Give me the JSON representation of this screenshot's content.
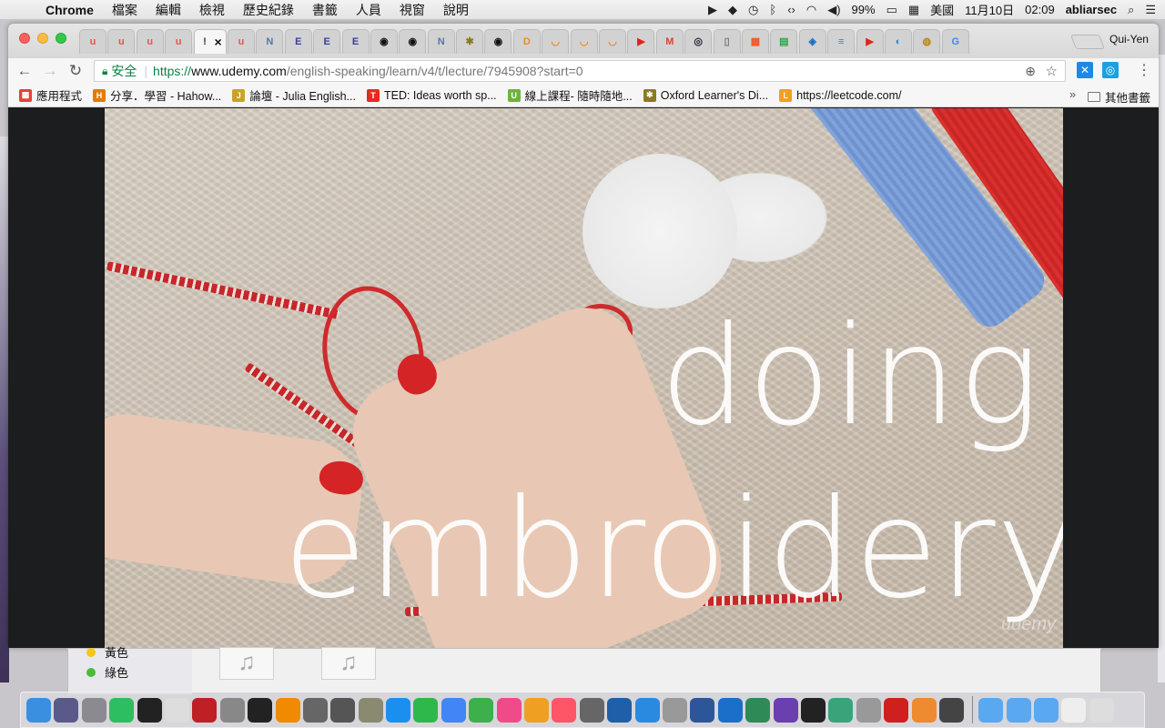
{
  "menubar": {
    "app": "Chrome",
    "menus": [
      "檔案",
      "編輯",
      "檢視",
      "歷史紀錄",
      "書籤",
      "人員",
      "視窗",
      "說明"
    ],
    "battery": "99%",
    "input_source": "美國",
    "date": "11月10日",
    "time": "02:09",
    "user": "abliarsec"
  },
  "browser": {
    "profile": "Qui-Yen",
    "tabs": [
      {
        "icon": "u",
        "color": "#ec5252"
      },
      {
        "icon": "u",
        "color": "#ec5252"
      },
      {
        "icon": "u",
        "color": "#ec5252"
      },
      {
        "icon": "u",
        "color": "#ec5252"
      },
      {
        "icon": "!",
        "color": "#333"
      },
      {
        "icon": "u",
        "color": "#ec5252"
      },
      {
        "icon": "N",
        "color": "#5577aa"
      },
      {
        "icon": "E",
        "color": "#3a3f9a"
      },
      {
        "icon": "E",
        "color": "#3a3f9a"
      },
      {
        "icon": "E",
        "color": "#3a3f9a"
      },
      {
        "icon": "◉",
        "color": "#111"
      },
      {
        "icon": "◉",
        "color": "#111"
      },
      {
        "icon": "N",
        "color": "#5577aa"
      },
      {
        "icon": "✱",
        "color": "#8a7a20"
      },
      {
        "icon": "◉",
        "color": "#111"
      },
      {
        "icon": "D",
        "color": "#f08a24"
      },
      {
        "icon": "◡",
        "color": "#f08a24"
      },
      {
        "icon": "◡",
        "color": "#f08a24"
      },
      {
        "icon": "◡",
        "color": "#f08a24"
      },
      {
        "icon": "▶",
        "color": "#e62117"
      },
      {
        "icon": "M",
        "color": "#d44638"
      },
      {
        "icon": "◎",
        "color": "#223"
      },
      {
        "icon": "▯",
        "color": "#777"
      },
      {
        "icon": "▦",
        "color": "#f35325"
      },
      {
        "icon": "▤",
        "color": "#27a844"
      },
      {
        "icon": "◈",
        "color": "#1b6fc7"
      },
      {
        "icon": "≡",
        "color": "#1e88e5"
      },
      {
        "icon": "▶",
        "color": "#e62117"
      },
      {
        "icon": "◐",
        "color": "#1e88e5"
      },
      {
        "icon": "◍",
        "color": "#b8860b"
      },
      {
        "icon": "G",
        "color": "#4285f4"
      }
    ],
    "address": {
      "secure_label": "安全",
      "scheme": "https://",
      "host_sub": "www.",
      "host": "udemy.com",
      "path": "/english-speaking/learn/v4/t/lecture/7945908?start=0"
    },
    "bookmarks": [
      {
        "label": "應用程式",
        "icon_color": "#e0443a",
        "icon": "▦"
      },
      {
        "label": "分享．學習 - Hahow...",
        "icon_color": "#e57a00",
        "icon": "H"
      },
      {
        "label": "論壇 - Julia English...",
        "icon_color": "#c9a227",
        "icon": "J"
      },
      {
        "label": "TED: Ideas worth sp...",
        "icon_color": "#e62b1e",
        "icon": "T"
      },
      {
        "label": "線上課程- 隨時隨地...",
        "icon_color": "#6cb33f",
        "icon": "U"
      },
      {
        "label": "Oxford Learner's Di...",
        "icon_color": "#8a7a20",
        "icon": "✱"
      },
      {
        "label": "https://leetcode.com/",
        "icon_color": "#f0a020",
        "icon": "L"
      }
    ],
    "bookmarks_other": "其他書籤"
  },
  "video": {
    "caption_line1": "doing",
    "caption_line2": "embroidery",
    "watermark": "udemy"
  },
  "finder": {
    "tags": [
      {
        "label": "黃色",
        "color": "#f5c518"
      },
      {
        "label": "綠色",
        "color": "#4cbb3c"
      }
    ]
  },
  "dock": {
    "apps": [
      {
        "name": "Finder",
        "color": "#3b8fe0"
      },
      {
        "name": "Siri",
        "color": "#5a5a8a"
      },
      {
        "name": "Launchpad",
        "color": "#8a8a90"
      },
      {
        "name": "Evernote",
        "color": "#2dbe60"
      },
      {
        "name": "Activity",
        "color": "#222"
      },
      {
        "name": "Script",
        "color": "#ddd"
      },
      {
        "name": "FileZilla",
        "color": "#bf2026"
      },
      {
        "name": "System Preferences",
        "color": "#888"
      },
      {
        "name": "Terminal",
        "color": "#222"
      },
      {
        "name": "VLC",
        "color": "#f08a00"
      },
      {
        "name": "Ubuntu",
        "color": "#666"
      },
      {
        "name": "Screenshot",
        "color": "#555"
      },
      {
        "name": "Preview",
        "color": "#8a8a70"
      },
      {
        "name": "App Store",
        "color": "#1b8ff0"
      },
      {
        "name": "FaceTime",
        "color": "#2eb84b"
      },
      {
        "name": "Chrome",
        "color": "#4285f4"
      },
      {
        "name": "Sourcetree",
        "color": "#3db04b"
      },
      {
        "name": "iTunes",
        "color": "#f04a8a"
      },
      {
        "name": "iBooks",
        "color": "#f0a020"
      },
      {
        "name": "Photos",
        "color": "#f56"
      },
      {
        "name": "Database",
        "color": "#666"
      },
      {
        "name": "VirtualBox",
        "color": "#1f5ea8"
      },
      {
        "name": "WiFi",
        "color": "#2a8ae0"
      },
      {
        "name": "Preview2",
        "color": "#999"
      },
      {
        "name": "Word",
        "color": "#2b579a"
      },
      {
        "name": "QuickTime",
        "color": "#1b6fc7"
      },
      {
        "name": "Network",
        "color": "#2e8b57"
      },
      {
        "name": "Podcasts",
        "color": "#6a3fb0"
      },
      {
        "name": "PyCharm",
        "color": "#222"
      },
      {
        "name": "Atom",
        "color": "#3aa37a"
      },
      {
        "name": "Rocket",
        "color": "#999"
      },
      {
        "name": "Acrobat",
        "color": "#d01f1f"
      },
      {
        "name": "Sketch",
        "color": "#f08a30"
      },
      {
        "name": "Panda",
        "color": "#444"
      }
    ],
    "folders": [
      {
        "name": "Applications",
        "color": "#5aa8f0"
      },
      {
        "name": "Documents",
        "color": "#5aa8f0"
      },
      {
        "name": "Downloads",
        "color": "#5aa8f0"
      },
      {
        "name": "Stack",
        "color": "#eee"
      },
      {
        "name": "Trash",
        "color": "#ddd"
      }
    ]
  }
}
